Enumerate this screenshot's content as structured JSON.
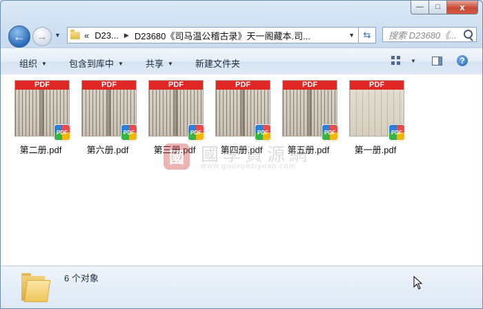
{
  "window": {
    "caption_buttons": {
      "minimize": "—",
      "maximize": "□",
      "close": "x"
    }
  },
  "nav": {
    "back_glyph": "←",
    "forward_glyph": "→",
    "recent_glyph": "▼"
  },
  "address_bar": {
    "overflow": "«",
    "crumb1": "D23...",
    "crumb2": "D23680《司马温公稽古录》天一阁藏本.司...",
    "dropdown": "▼",
    "refresh_glyph": "⇆"
  },
  "search": {
    "placeholder": "搜索 D23680《..."
  },
  "toolbar": {
    "organize": "组织",
    "include_in_library": "包含到库中",
    "share": "共享",
    "new_folder": "新建文件夹",
    "help": "?"
  },
  "files": [
    {
      "name": "第二册.pdf",
      "badge": "PDF",
      "band": "PDF",
      "style": "dense"
    },
    {
      "name": "第六册.pdf",
      "badge": "PDF",
      "band": "PDF",
      "style": "dense"
    },
    {
      "name": "第三册.pdf",
      "badge": "PDF",
      "band": "PDF",
      "style": "dense"
    },
    {
      "name": "第四册.pdf",
      "badge": "PDF",
      "band": "PDF",
      "style": "dense"
    },
    {
      "name": "第五册.pdf",
      "badge": "PDF",
      "band": "PDF",
      "style": "dense"
    },
    {
      "name": "第一册.pdf",
      "badge": "PDF",
      "band": "PDF",
      "style": "light"
    }
  ],
  "watermark": {
    "seal": "國",
    "title": "國學資源網",
    "url": "www.guoxueziyuan.com"
  },
  "status": {
    "count": "6 个对象"
  },
  "colors": {
    "pdf_band": "#e12626",
    "accent": "#2a6ab8"
  }
}
